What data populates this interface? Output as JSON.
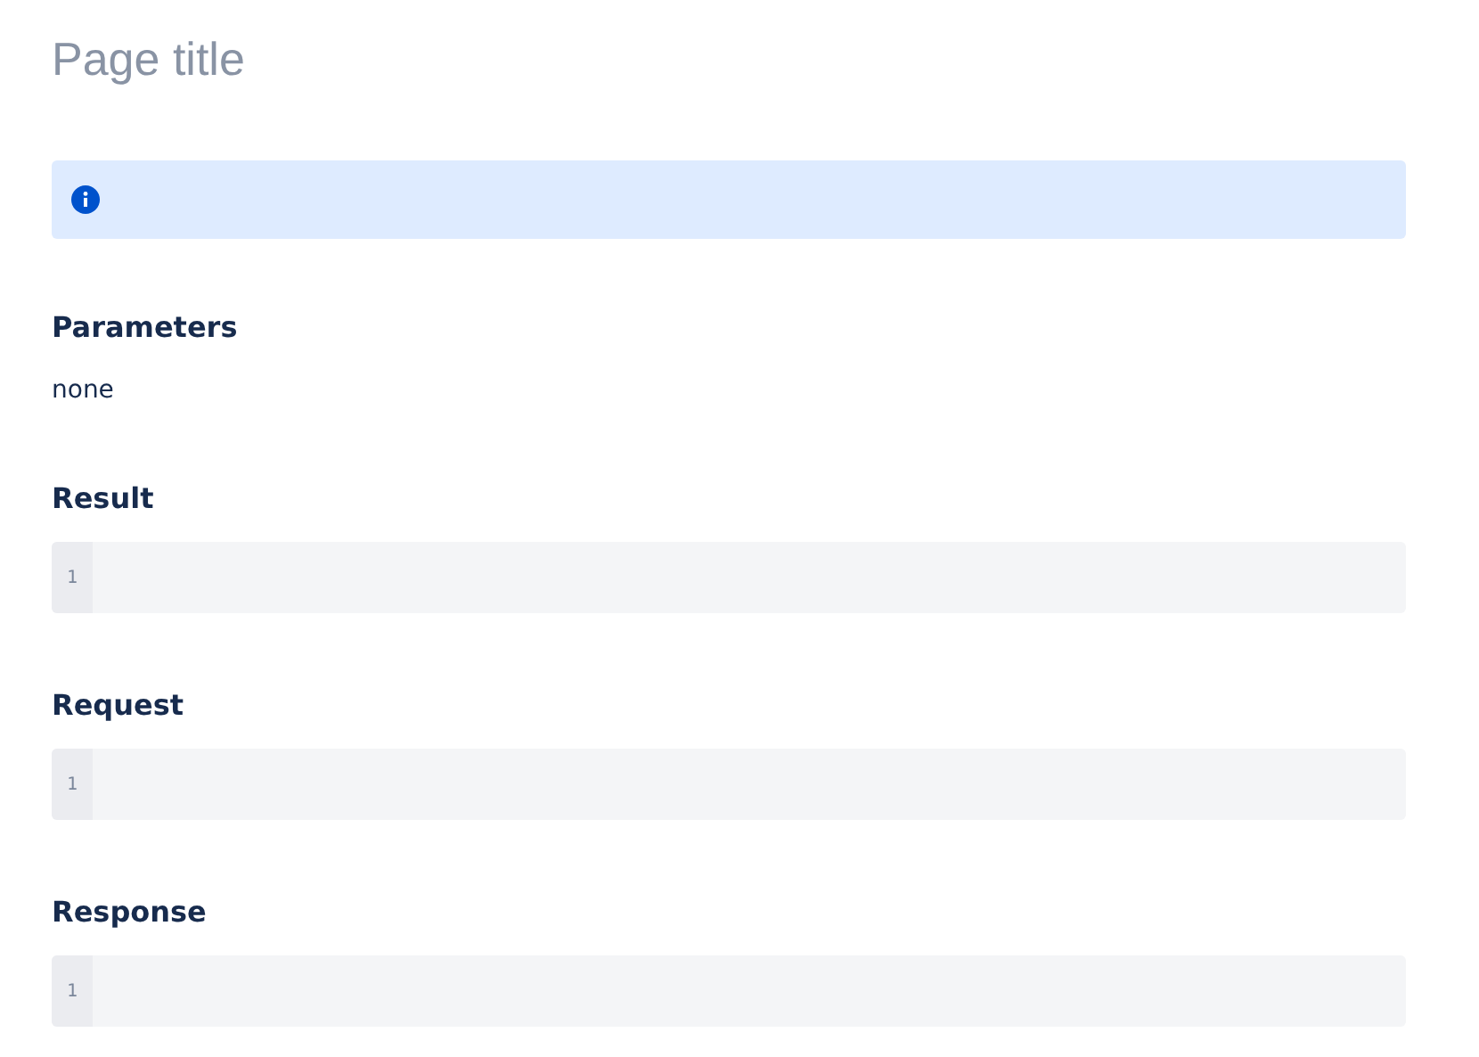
{
  "page_title": "Page title",
  "alert": {
    "kind": "info"
  },
  "parameters": {
    "heading": "Parameters",
    "value": "none"
  },
  "code_sections": [
    {
      "heading": "Result",
      "line_numbers": [
        "1"
      ]
    },
    {
      "heading": "Request",
      "line_numbers": [
        "1"
      ]
    },
    {
      "heading": "Response",
      "line_numbers": [
        "1"
      ]
    }
  ]
}
